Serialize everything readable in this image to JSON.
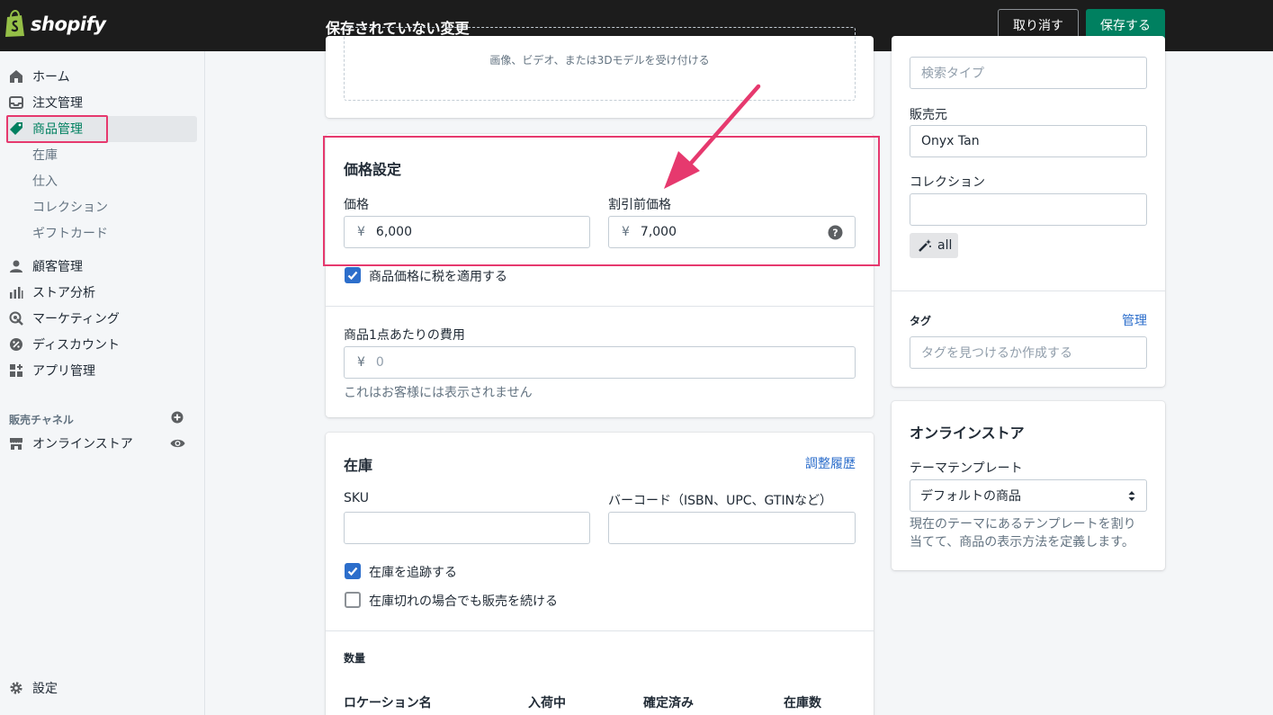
{
  "topbar": {
    "brand": "shopify",
    "status": "保存されていない変更",
    "cancel_label": "取り消す",
    "save_label": "保存する"
  },
  "sidebar": {
    "items": [
      {
        "label": "ホーム",
        "icon": "home-icon"
      },
      {
        "label": "注文管理",
        "icon": "inbox-icon"
      },
      {
        "label": "商品管理",
        "icon": "tag-icon",
        "active": true
      },
      {
        "label": "在庫",
        "sub": true
      },
      {
        "label": "仕入",
        "sub": true
      },
      {
        "label": "コレクション",
        "sub": true
      },
      {
        "label": "ギフトカード",
        "sub": true
      },
      {
        "label": "顧客管理",
        "icon": "person-icon"
      },
      {
        "label": "ストア分析",
        "icon": "bar-chart-icon"
      },
      {
        "label": "マーケティング",
        "icon": "target-icon"
      },
      {
        "label": "ディスカウント",
        "icon": "discount-icon"
      },
      {
        "label": "アプリ管理",
        "icon": "apps-icon"
      }
    ],
    "channels_title": "販売チャネル",
    "online_store": "オンラインストア",
    "settings": "設定"
  },
  "media": {
    "hint": "画像、ビデオ、または3Dモデルを受け付ける"
  },
  "pricing": {
    "title": "価格設定",
    "price_label": "価格",
    "price_prefix": "¥",
    "price_value": "6,000",
    "compare_label": "割引前価格",
    "compare_prefix": "¥",
    "compare_value": "7,000",
    "tax_label": "商品価格に税を適用する",
    "cost_label": "商品1点あたりの費用",
    "cost_prefix": "¥",
    "cost_placeholder": "0",
    "cost_help": "これはお客様には表示されません"
  },
  "inventory": {
    "title": "在庫",
    "history_link": "調整履歴",
    "sku_label": "SKU",
    "barcode_label": "バーコード（ISBN、UPC、GTINなど）",
    "track_label": "在庫を追跡する",
    "continue_label": "在庫切れの場合でも販売を続ける",
    "quantity_title": "数量",
    "columns": [
      "ロケーション名",
      "入荷中",
      "確定済み",
      "在庫数"
    ]
  },
  "organization": {
    "type_placeholder": "検索タイプ",
    "vendor_label": "販売元",
    "vendor_value": "Onyx Tan",
    "collections_label": "コレクション",
    "chip_label": "all",
    "tags_title": "タグ",
    "tags_manage": "管理",
    "tags_placeholder": "タグを見つけるか作成する"
  },
  "online_store_card": {
    "title": "オンラインストア",
    "template_label": "テーマテンプレート",
    "template_value": "デフォルトの商品",
    "help": "現在のテーマにあるテンプレートを割り当てて、商品の表示方法を定義します。"
  },
  "colors": {
    "accent": "#008060",
    "highlight": "#e6396e",
    "link": "#2c6ecb"
  }
}
